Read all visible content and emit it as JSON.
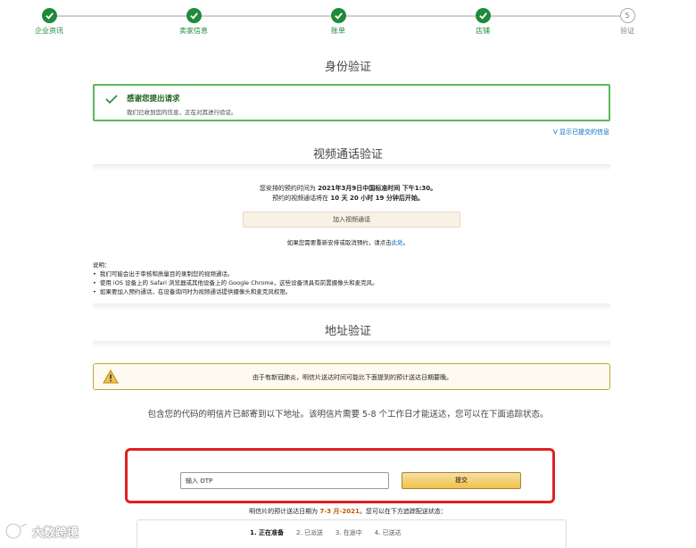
{
  "stepper": {
    "steps": [
      {
        "label": "企业资讯",
        "status": "done"
      },
      {
        "label": "卖家信息",
        "status": "done"
      },
      {
        "label": "账单",
        "status": "done"
      },
      {
        "label": "店铺",
        "status": "done"
      },
      {
        "label": "验证",
        "status": "pending",
        "number": "5"
      }
    ]
  },
  "identity": {
    "title": "身份验证",
    "success_title": "感谢您提出请求",
    "success_text": "我们已收到您的信息，正在对其进行验证。",
    "show_link": "V 显示已提交的信息"
  },
  "video": {
    "title": "视频通话验证",
    "line1_prefix": "您安排的预约时间为 ",
    "line1_value": "2021年3月9日中国标准时间 下午1:30。",
    "line2_prefix": "预约的视频通话将在 ",
    "line2_value": "10 天 20 小时 19 分钟后开始。",
    "join_button": "加入视频通话",
    "reschedule_prefix": "如果您需要重新安排或取消预约，请点击",
    "reschedule_link": "此处",
    "reschedule_suffix": "。"
  },
  "notes": {
    "heading": "说明：",
    "items": [
      "我们可能会出于审核和质量目的录制您的视频通话。",
      "使用 iOS 设备上的 Safari 浏览器或其他设备上的 Google Chrome，这些设备须具有前置摄像头和麦克风。",
      "如果要加入预约通话，在设备询问时为视频通话提供摄像头和麦克风权限。"
    ]
  },
  "address": {
    "title": "地址验证",
    "warning_text": "由于有新冠肺炎，明信片送达时间可能比下面提到的预计送达日期要晚。",
    "postcard_text": "包含您的代码的明信片已邮寄到以下地址。该明信片需要 5-8 个工作日才能送达，您可以在下面追踪状态。",
    "otp_placeholder": "输入 OTP",
    "submit_button": "提交",
    "est_prefix": "明信片的预计送达日期为 ",
    "est_date": "7-3 月-2021",
    "est_suffix": "。您可以在下方追踪配送状态：",
    "tracking_steps": [
      "1. 正在准备",
      "2. 已派送",
      "3. 在途中",
      "4. 已送达"
    ]
  },
  "watermark": {
    "text": "大数跨境"
  },
  "colors": {
    "success_green": "#1f8a3b",
    "link_blue": "#0066c0",
    "highlight_red": "#e02020",
    "button_gold": "#f0c14b"
  }
}
